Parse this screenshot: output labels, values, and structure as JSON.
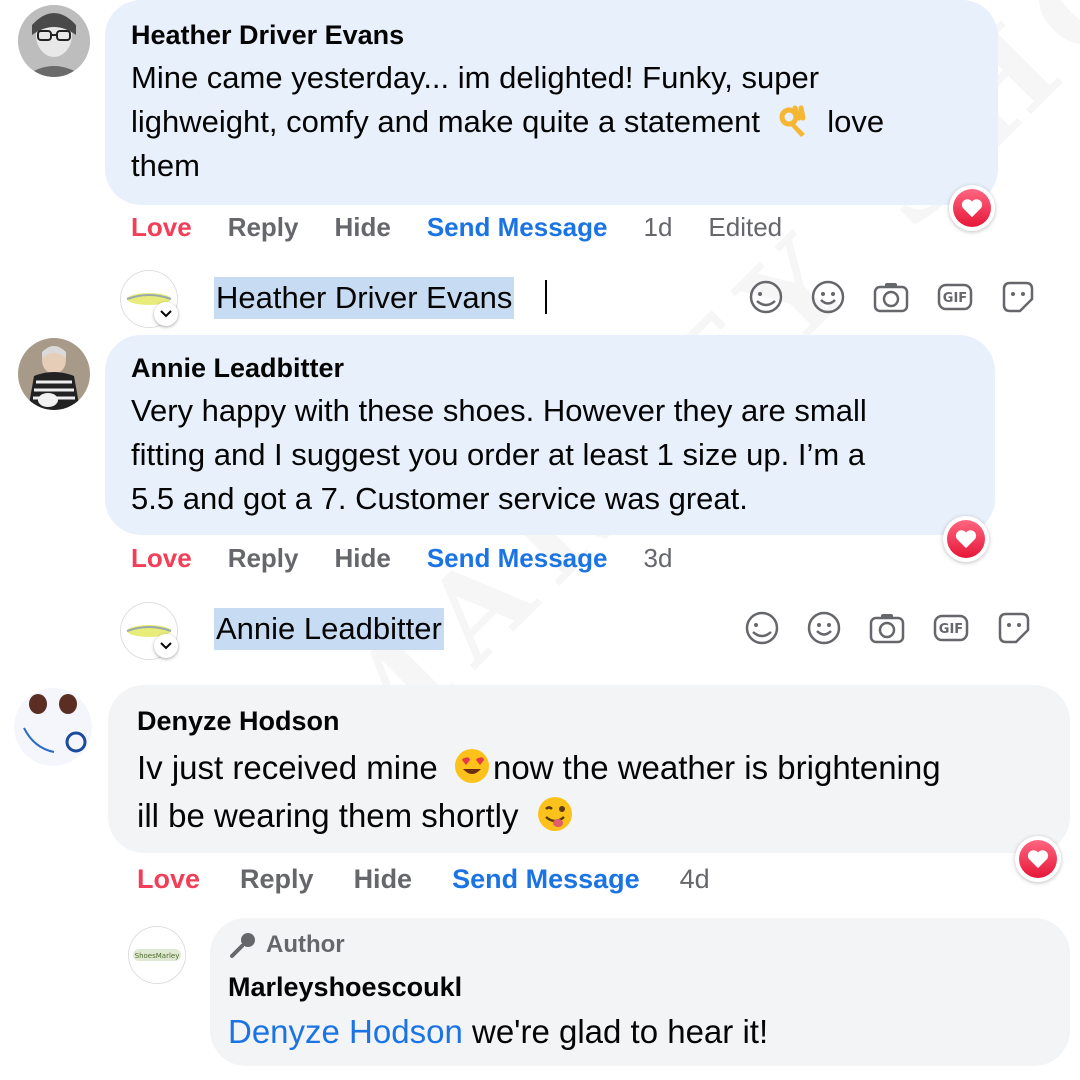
{
  "comments": [
    {
      "author": "Heather Driver Evans",
      "text_1": "Mine came yesterday... im delighted! Funky, super",
      "text_2_a": "lighweight, comfy and make quite a statement",
      "text_2_b": "love",
      "text_3": "them",
      "actions": {
        "love": "Love",
        "reply": "Reply",
        "hide": "Hide",
        "send": "Send Message",
        "time": "1d",
        "edited": "Edited"
      }
    },
    {
      "author": "Annie Leadbitter",
      "text_1": "Very happy with these shoes. However they are small",
      "text_2": "fitting and I suggest you order at least 1 size up. I’m a",
      "text_3": "5.5 and got a 7. Customer service was great.",
      "actions": {
        "love": "Love",
        "reply": "Reply",
        "hide": "Hide",
        "send": "Send Message",
        "time": "3d"
      }
    },
    {
      "author": "Denyze Hodson",
      "text_1_a": "Iv just received mine",
      "text_1_b": "now the weather is brightening",
      "text_2": "ill be wearing them shortly",
      "actions": {
        "love": "Love",
        "reply": "Reply",
        "hide": "Hide",
        "send": "Send Message",
        "time": "4d"
      }
    }
  ],
  "reply_boxes": [
    {
      "mention": "Heather Driver Evans"
    },
    {
      "mention": "Annie Leadbitter"
    }
  ],
  "author_reply": {
    "badge": "Author",
    "name": "Marleyshoescoukl",
    "mention": "Denyze Hodson",
    "text": " we're glad to hear it!"
  },
  "colors": {
    "love": "#f33e58",
    "link": "#1b74e4",
    "muted": "#65676b",
    "bubble": "#e7f0fb"
  }
}
